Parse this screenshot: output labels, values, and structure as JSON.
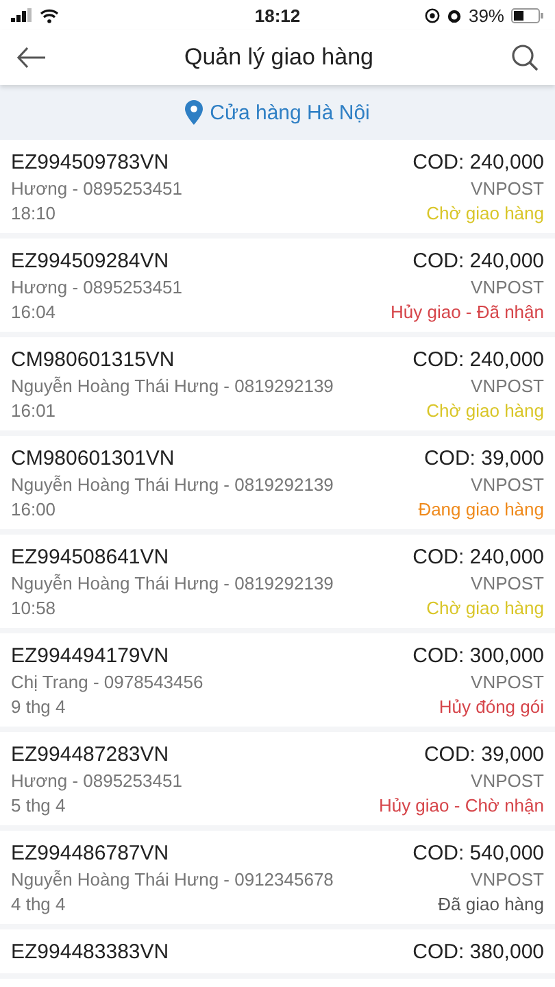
{
  "status_bar": {
    "time": "18:12",
    "battery": "39%"
  },
  "header": {
    "title": "Quản lý giao hàng"
  },
  "store": {
    "name": "Cửa hàng Hà Nội"
  },
  "orders": [
    {
      "code": "EZ994509783VN",
      "cod": "COD: 240,000",
      "customer": "Hương - 0895253451",
      "carrier": "VNPOST",
      "time": "18:10",
      "status": "Chờ giao hàng",
      "color": "#d9c629"
    },
    {
      "code": "EZ994509284VN",
      "cod": "COD: 240,000",
      "customer": "Hương - 0895253451",
      "carrier": "VNPOST",
      "time": "16:04",
      "status": "Hủy giao - Đã nhận",
      "color": "#d6454a"
    },
    {
      "code": "CM980601315VN",
      "cod": "COD: 240,000",
      "customer": "Nguyễn Hoàng Thái Hưng - 0819292139",
      "carrier": "VNPOST",
      "time": "16:01",
      "status": "Chờ giao hàng",
      "color": "#d9c629"
    },
    {
      "code": "CM980601301VN",
      "cod": "COD: 39,000",
      "customer": "Nguyễn Hoàng Thái Hưng - 0819292139",
      "carrier": "VNPOST",
      "time": "16:00",
      "status": "Đang giao hàng",
      "color": "#ef8a1c"
    },
    {
      "code": "EZ994508641VN",
      "cod": "COD: 240,000",
      "customer": "Nguyễn Hoàng Thái Hưng - 0819292139",
      "carrier": "VNPOST",
      "time": "10:58",
      "status": "Chờ giao hàng",
      "color": "#d9c629"
    },
    {
      "code": "EZ994494179VN",
      "cod": "COD: 300,000",
      "customer": "Chị Trang - 0978543456",
      "carrier": "VNPOST",
      "time": "9 thg 4",
      "status": "Hủy đóng gói",
      "color": "#d6454a"
    },
    {
      "code": "EZ994487283VN",
      "cod": "COD: 39,000",
      "customer": "Hương - 0895253451",
      "carrier": "VNPOST",
      "time": "5 thg 4",
      "status": "Hủy giao - Chờ nhận",
      "color": "#d6454a"
    },
    {
      "code": "EZ994486787VN",
      "cod": "COD: 540,000",
      "customer": "Nguyễn Hoàng Thái Hưng - 0912345678",
      "carrier": "VNPOST",
      "time": "4 thg 4",
      "status": "Đã giao hàng",
      "color": "#555555"
    },
    {
      "code": "EZ994483383VN",
      "cod": "COD: 380,000"
    }
  ]
}
